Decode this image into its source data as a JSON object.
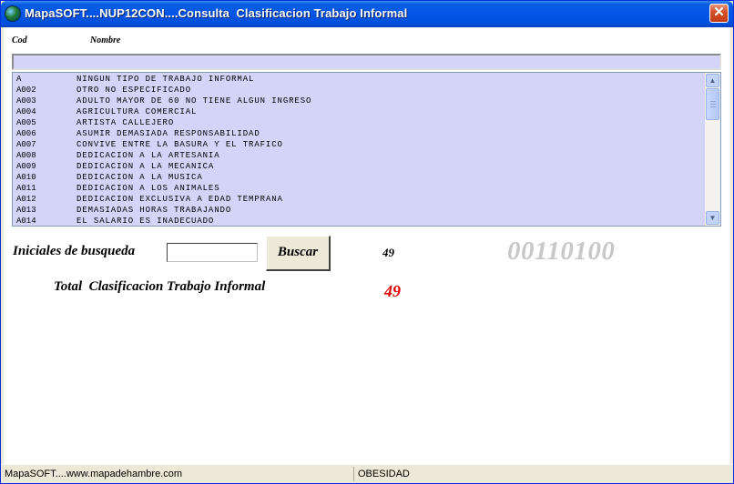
{
  "window": {
    "title": "MapaSOFT....NUP12CON....Consulta  Clasificacion Trabajo Informal",
    "close_glyph": "✕"
  },
  "columns": {
    "cod": "Cod",
    "nombre": "Nombre"
  },
  "filter_value": "",
  "list": {
    "rows": [
      {
        "cod": "A",
        "nombre": "NINGUN TIPO DE TRABAJO INFORMAL"
      },
      {
        "cod": "A002",
        "nombre": "OTRO NO ESPECIFICADO"
      },
      {
        "cod": "A003",
        "nombre": "ADULTO MAYOR DE 60 NO TIENE ALGUN INGRESO"
      },
      {
        "cod": "A004",
        "nombre": "AGRICULTURA COMERCIAL"
      },
      {
        "cod": "A005",
        "nombre": "ARTISTA CALLEJERO"
      },
      {
        "cod": "A006",
        "nombre": "ASUMIR DEMASIADA RESPONSABILIDAD"
      },
      {
        "cod": "A007",
        "nombre": "CONVIVE ENTRE LA BASURA Y EL TRAFICO"
      },
      {
        "cod": "A008",
        "nombre": "DEDICACION A LA ARTESANIA"
      },
      {
        "cod": "A009",
        "nombre": "DEDICACION A LA MECANICA"
      },
      {
        "cod": "A010",
        "nombre": "DEDICACION A LA MUSICA"
      },
      {
        "cod": "A011",
        "nombre": "DEDICACION A LOS ANIMALES"
      },
      {
        "cod": "A012",
        "nombre": "DEDICACION EXCLUSIVA A EDAD TEMPRANA"
      },
      {
        "cod": "A013",
        "nombre": "DEMASIADAS HORAS TRABAJANDO"
      },
      {
        "cod": "A014",
        "nombre": "EL SALARIO ES INADECUADO"
      }
    ],
    "scroll_up_glyph": "▲",
    "scroll_down_glyph": "▼"
  },
  "search": {
    "label": "Iniciales de busqueda",
    "input_value": "",
    "button_label": "Buscar"
  },
  "count_small": "49",
  "code_big": "00110100",
  "total": {
    "label": "Total  Clasificacion Trabajo Informal",
    "value": "49"
  },
  "status": {
    "left": "MapaSOFT....www.mapadehambre.com",
    "right": "OBESIDAD"
  },
  "colors": {
    "list_background": "#d4d4f8",
    "titlebar": "#0154e6",
    "total_value": "#e00000",
    "code_big": "#c8c8c8"
  },
  "icons": {
    "app": "globe-icon",
    "close": "close-icon",
    "scroll_up": "arrow-up-icon",
    "scroll_down": "arrow-down-icon"
  }
}
